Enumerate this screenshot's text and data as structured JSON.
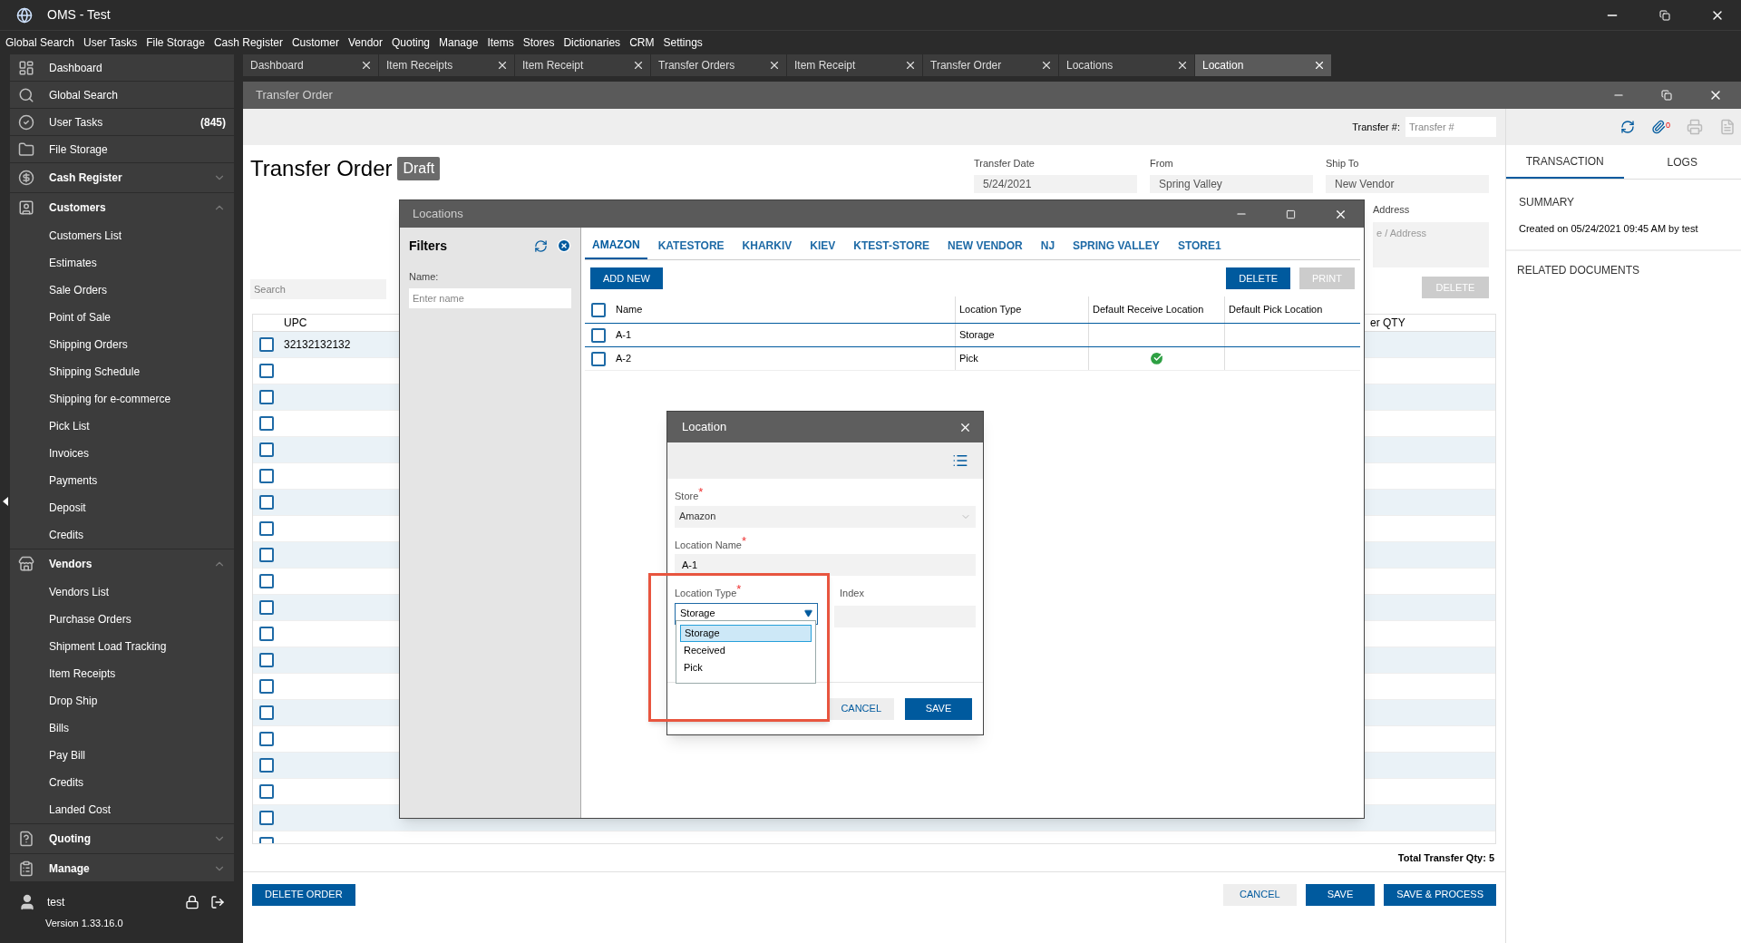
{
  "app": {
    "title": "OMS - Test"
  },
  "menu": [
    "Global Search",
    "User Tasks",
    "File Storage",
    "Cash Register",
    "Customer",
    "Vendor",
    "Quoting",
    "Manage",
    "Items",
    "Stores",
    "Dictionaries",
    "CRM",
    "Settings"
  ],
  "sidebar": {
    "items": [
      {
        "label": "Dashboard",
        "kind": "link"
      },
      {
        "label": "Global Search",
        "kind": "link"
      },
      {
        "label": "User Tasks",
        "kind": "link",
        "badge": "(845)"
      },
      {
        "label": "File Storage",
        "kind": "link"
      },
      {
        "label": "Cash Register",
        "kind": "group",
        "expanded": false
      },
      {
        "label": "Customers",
        "kind": "group",
        "expanded": true,
        "children": [
          "Customers List",
          "Estimates",
          "Sale Orders",
          "Point of Sale",
          "Shipping Orders",
          "Shipping Schedule",
          "Shipping for e-commerce",
          "Pick List",
          "Invoices",
          "Payments",
          "Deposit",
          "Credits"
        ]
      },
      {
        "label": "Vendors",
        "kind": "group",
        "expanded": true,
        "children": [
          "Vendors List",
          "Purchase Orders",
          "Shipment Load Tracking",
          "Item Receipts",
          "Drop Ship",
          "Bills",
          "Pay Bill",
          "Credits",
          "Landed Cost"
        ]
      },
      {
        "label": "Quoting",
        "kind": "group",
        "expanded": false
      },
      {
        "label": "Manage",
        "kind": "group",
        "expanded": false
      }
    ],
    "user": "test",
    "version": "Version 1.33.16.0"
  },
  "doc_tabs": [
    {
      "label": "Dashboard",
      "selected": false
    },
    {
      "label": "Item Receipts",
      "selected": false
    },
    {
      "label": "Item Receipt",
      "selected": false
    },
    {
      "label": "Transfer Orders",
      "selected": false
    },
    {
      "label": "Item Receipt",
      "selected": false
    },
    {
      "label": "Transfer Order",
      "selected": false
    },
    {
      "label": "Locations",
      "selected": false
    },
    {
      "label": "Location",
      "selected": true
    }
  ],
  "transfer_window": {
    "title": "Transfer Order",
    "transfer_no": {
      "label": "Transfer #:",
      "placeholder": "Transfer #"
    },
    "heading": "Transfer Order",
    "status": "Draft",
    "fields": [
      {
        "label": "Transfer Date",
        "value": "5/24/2021"
      },
      {
        "label": "From",
        "value": "Spring Valley"
      },
      {
        "label": "Ship To",
        "value": "New Vendor"
      }
    ],
    "address": {
      "label": "Address",
      "placeholder": "e / Address"
    },
    "search": {
      "placeholder": "Search"
    },
    "delete_button": {
      "label": "DELETE",
      "disabled": true
    },
    "columns": [
      "UPC",
      "er QTY"
    ],
    "rows": [
      {
        "upc": "32132132132",
        "checked": false
      },
      {
        "checked": false
      },
      {
        "checked": false
      },
      {
        "checked": false
      },
      {
        "checked": false
      },
      {
        "checked": false
      },
      {
        "checked": false
      },
      {
        "checked": false
      },
      {
        "checked": false
      },
      {
        "checked": false
      },
      {
        "checked": false
      },
      {
        "checked": false
      },
      {
        "checked": false
      },
      {
        "checked": false
      },
      {
        "checked": false
      },
      {
        "checked": false
      },
      {
        "checked": false
      },
      {
        "checked": false
      },
      {
        "checked": false
      },
      {
        "checked": false
      }
    ],
    "total": "Total Transfer Qty: 5",
    "buttons": {
      "delete_order": "DELETE ORDER",
      "cancel": "CANCEL",
      "save": "SAVE",
      "save_process": "SAVE & PROCESS"
    }
  },
  "right_panel": {
    "attachments": "0",
    "tabs": [
      {
        "label": "TRANSACTION",
        "selected": true
      },
      {
        "label": "LOGS",
        "selected": false
      }
    ],
    "summary_heading": "SUMMARY",
    "summary": "Created on 05/24/2021 09:45 AM by test",
    "related_heading": "RELATED DOCUMENTS"
  },
  "locations_window": {
    "title": "Locations",
    "filters": {
      "heading": "Filters",
      "name_label": "Name:",
      "name_placeholder": "Enter name"
    },
    "store_tabs": [
      {
        "label": "AMAZON",
        "selected": true
      },
      {
        "label": "KATESTORE",
        "selected": false
      },
      {
        "label": "KHARKIV",
        "selected": false
      },
      {
        "label": "KIEV",
        "selected": false
      },
      {
        "label": "KTEST-STORE",
        "selected": false
      },
      {
        "label": "NEW VENDOR",
        "selected": false
      },
      {
        "label": "NJ",
        "selected": false
      },
      {
        "label": "SPRING VALLEY",
        "selected": false
      },
      {
        "label": "STORE1",
        "selected": false
      }
    ],
    "buttons": [
      {
        "label": "ADD NEW",
        "disabled": false
      },
      {
        "label": "DELETE",
        "disabled": false
      },
      {
        "label": "PRINT",
        "disabled": true
      }
    ],
    "select_all": {
      "checked": false
    },
    "columns": [
      "Name",
      "Location Type",
      "Default Receive Location",
      "Default Pick Location"
    ],
    "rows": [
      {
        "name": "A-1",
        "type": "Storage",
        "checked": false,
        "default_receive": false,
        "default_pick": false,
        "selected": true
      },
      {
        "name": "A-2",
        "type": "Pick",
        "checked": false,
        "default_receive": true,
        "default_pick": false,
        "selected": false
      }
    ]
  },
  "location_dialog": {
    "title": "Location",
    "store": {
      "label": "Store",
      "required_mark": "*",
      "value": "Amazon",
      "disabled": true
    },
    "name": {
      "label": "Location Name",
      "required_mark": "*",
      "value": "A-1"
    },
    "type": {
      "label": "Location Type",
      "required_mark": "*",
      "value": "Storage"
    },
    "index": {
      "label": "Index"
    },
    "options": [
      {
        "label": "Storage",
        "selected": true
      },
      {
        "label": "Received",
        "selected": false
      },
      {
        "label": "Pick",
        "selected": false
      }
    ],
    "buttons": {
      "cancel": "CANCEL",
      "save": "SAVE"
    }
  }
}
